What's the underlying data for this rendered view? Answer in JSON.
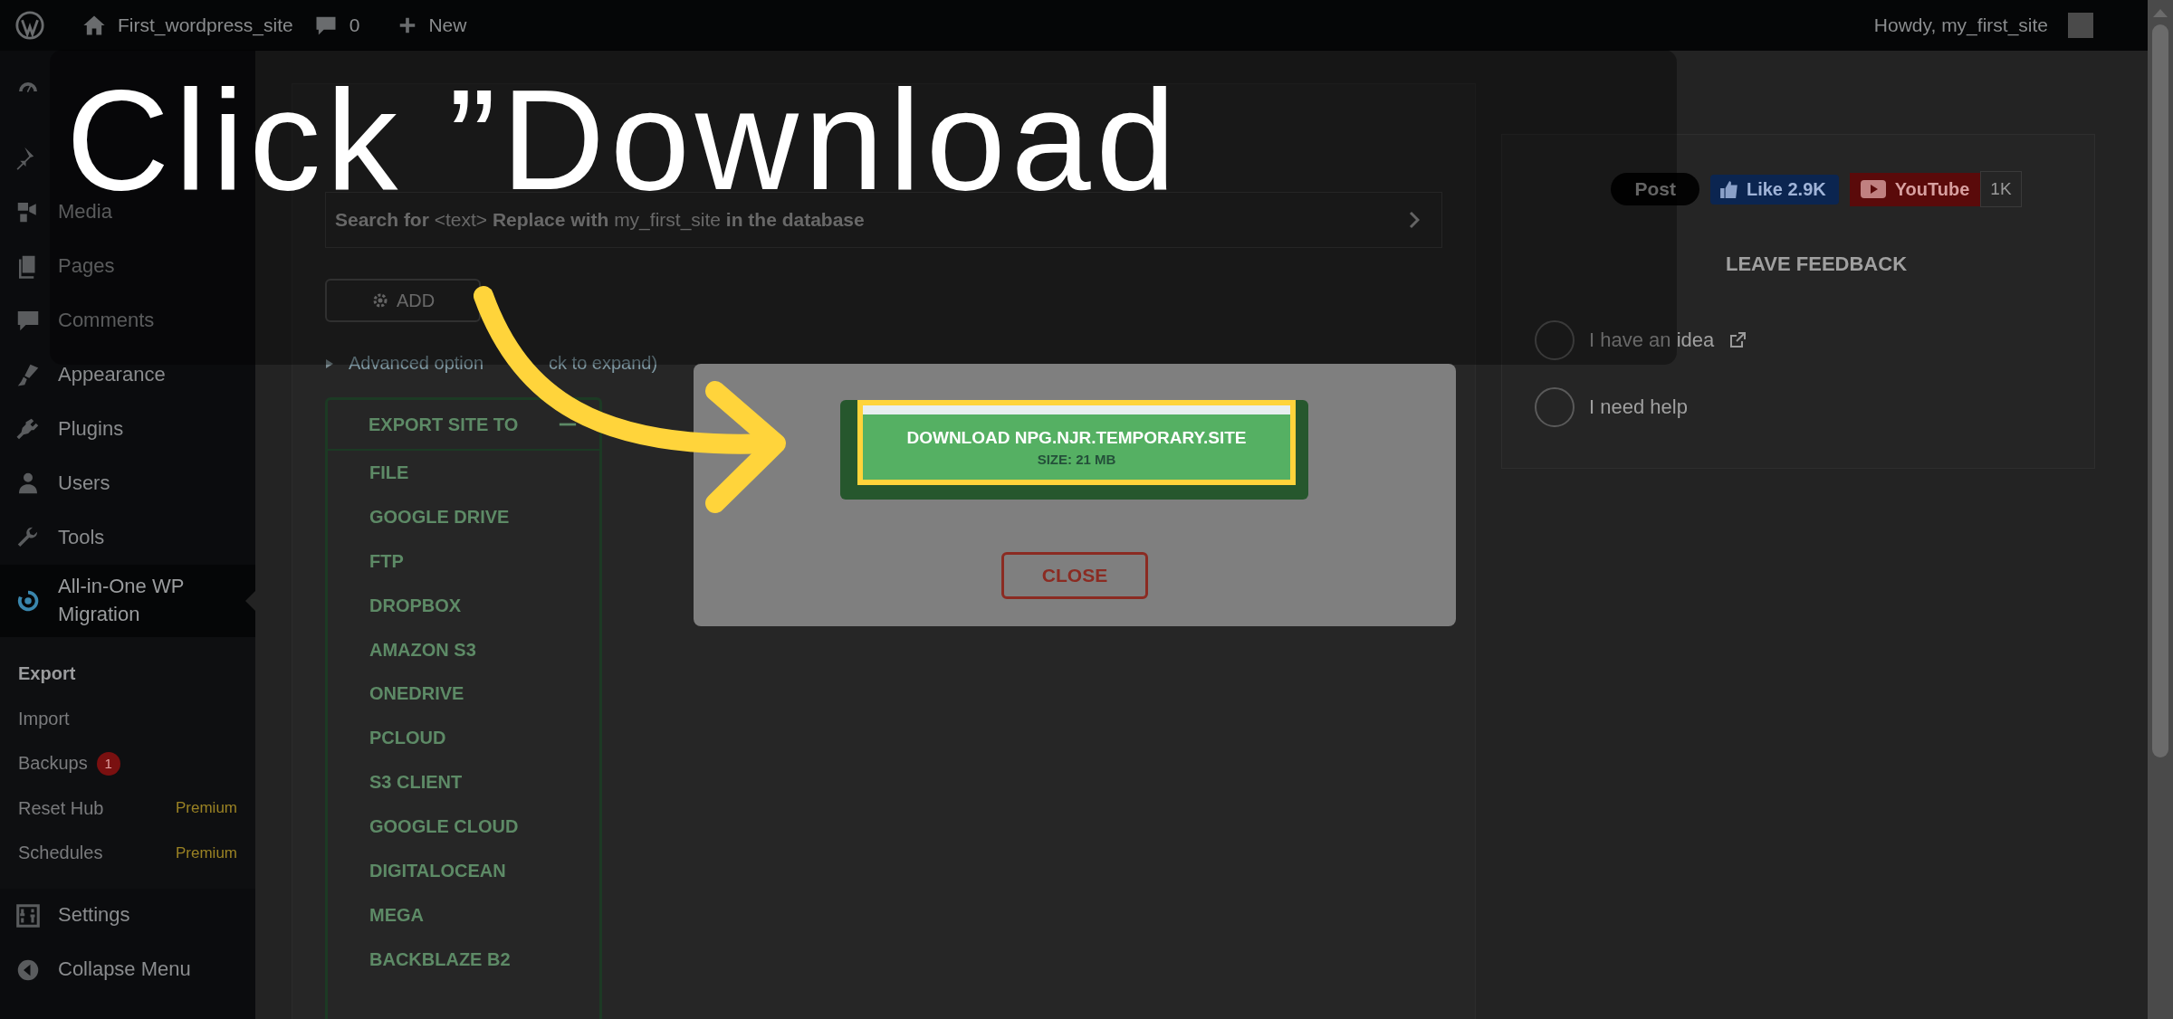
{
  "top_bar": {
    "site_name": "First_wordpress_site",
    "comments_count": "0",
    "new_label": "New",
    "greeting": "Howdy, my_first_site"
  },
  "sidebar": {
    "item_groups": [
      [
        {
          "label": "Media",
          "selected": false
        },
        {
          "label": "Pages",
          "selected": false
        },
        {
          "label": "Comments",
          "selected": false
        }
      ],
      [
        {
          "label": "Appearance",
          "selected": false
        },
        {
          "label": "Plugins",
          "selected": false
        },
        {
          "label": "Users",
          "selected": false
        },
        {
          "label": "Tools",
          "selected": false
        },
        {
          "label": "All-in-One WP Migration",
          "selected": true
        }
      ]
    ],
    "submenu": [
      {
        "label": "Export",
        "selected": true
      },
      {
        "label": "Import",
        "selected": false
      },
      {
        "label": "Backups",
        "selected": false,
        "badge": "1"
      },
      {
        "label": "Reset Hub",
        "selected": false,
        "tag": "Premium"
      },
      {
        "label": "Schedules",
        "selected": false,
        "tag": "Premium"
      }
    ],
    "bottom_items": [
      {
        "label": "Settings",
        "selected": false
      },
      {
        "label": "Collapse Menu",
        "selected": false
      }
    ]
  },
  "main": {
    "search_replace": "**Search for** <text> **Replace with** my_first_site **in the database**",
    "add_button": "ADD",
    "advanced_options": {
      "before_arrow": "Advanced option",
      "after_arrow": "ck to expand)"
    },
    "export_panel": {
      "title": "EXPORT SITE TO",
      "expanded": true,
      "items": [
        "FILE",
        "GOOGLE DRIVE",
        "FTP",
        "DROPBOX",
        "AMAZON S3",
        "ONEDRIVE",
        "PCLOUD",
        "S3 CLIENT",
        "GOOGLE CLOUD",
        "DIGITALOCEAN",
        "MEGA",
        "BACKBLAZE B2"
      ]
    }
  },
  "right_panel": {
    "social": [
      {
        "kind": "post",
        "label": "Post"
      },
      {
        "kind": "like",
        "label": "Like 2.9K"
      },
      {
        "kind": "youtube",
        "label": "YouTube",
        "count": "1K"
      }
    ],
    "feedback_title": "LEAVE FEEDBACK",
    "feedback_options": [
      {
        "label": "I have an idea",
        "external": true,
        "selected": false
      },
      {
        "label": "I need help",
        "external": false,
        "selected": false
      }
    ]
  },
  "modal": {
    "download_button": "DOWNLOAD NPG.NJR.TEMPORARY.SITE",
    "size": "SIZE: 21 MB",
    "close_button": "CLOSE"
  },
  "caption": {
    "text": "Click ”Download"
  }
}
